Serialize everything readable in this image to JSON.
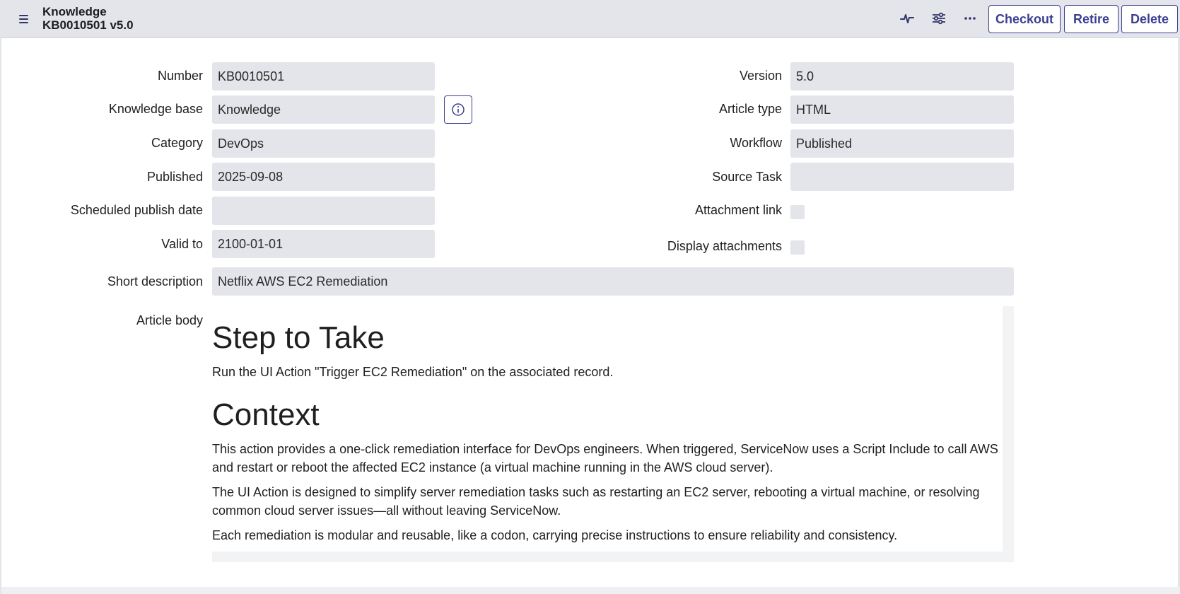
{
  "header": {
    "title_line1": "Knowledge",
    "title_line2": "KB0010501 v5.0",
    "icons": [
      "menu-icon",
      "activity-icon",
      "settings-sliders-icon",
      "more-options-icon",
      "info-icon"
    ],
    "buttons": {
      "checkout": "Checkout",
      "retire": "Retire",
      "delete": "Delete"
    },
    "accent_color": "#3b3f8f"
  },
  "form": {
    "left": {
      "number": {
        "label": "Number",
        "value": "KB0010501"
      },
      "knowledge_base": {
        "label": "Knowledge base",
        "value": "Knowledge"
      },
      "category": {
        "label": "Category",
        "value": "DevOps"
      },
      "published": {
        "label": "Published",
        "value": "2025-09-08"
      },
      "scheduled_publish_date": {
        "label": "Scheduled publish date",
        "value": ""
      },
      "valid_to": {
        "label": "Valid to",
        "value": "2100-01-01"
      }
    },
    "right": {
      "version": {
        "label": "Version",
        "value": "5.0"
      },
      "article_type": {
        "label": "Article type",
        "value": "HTML"
      },
      "workflow": {
        "label": "Workflow",
        "value": "Published"
      },
      "source_task": {
        "label": "Source Task",
        "value": ""
      },
      "attachment_link": {
        "label": "Attachment link",
        "checked": false
      },
      "display_attachments": {
        "label": "Display attachments",
        "checked": false
      }
    },
    "short_description": {
      "label": "Short description",
      "value": "Netflix AWS EC2 Remediation"
    },
    "article_body": {
      "label": "Article body",
      "heading1": "Step to Take",
      "para1": "Run the UI Action \"Trigger EC2 Remediation\" on the associated record.",
      "heading2": "Context",
      "para2": "This action provides a one-click remediation interface for DevOps engineers. When triggered, ServiceNow uses a Script Include to call AWS and restart or reboot the affected EC2 instance (a virtual machine running in the AWS cloud server).",
      "para3": "The UI Action is designed to simplify server remediation tasks such as restarting an EC2 server, rebooting a virtual machine, or resolving common cloud server issues—all without leaving ServiceNow.",
      "para4": "Each remediation is modular and reusable, like a codon, carrying precise instructions to ensure reliability and consistency."
    }
  }
}
